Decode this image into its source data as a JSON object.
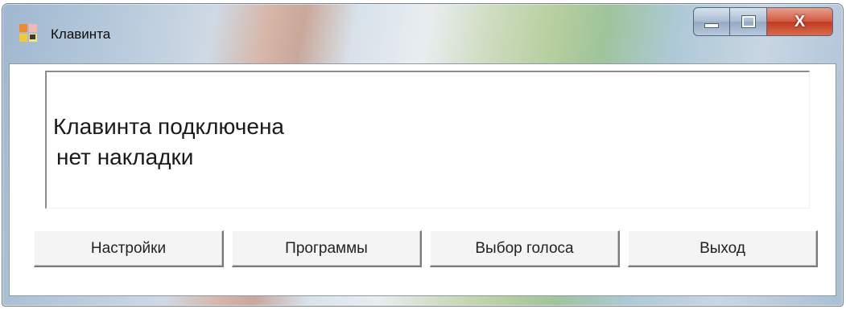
{
  "window": {
    "title": "Клавинта",
    "icon": "app-grid-icon",
    "controls": {
      "minimize_icon": "minimize-icon",
      "maximize_icon": "maximize-icon",
      "close_label": "X"
    }
  },
  "status": {
    "line1": "Клавинта подключена",
    "line2": "нет накладки"
  },
  "buttons": {
    "settings": "Настройки",
    "programs": "Программы",
    "voice": "Выбор голоса",
    "exit": "Выход"
  },
  "colors": {
    "close_button": "#c8452a",
    "window_frame": "#a9bfd4"
  }
}
